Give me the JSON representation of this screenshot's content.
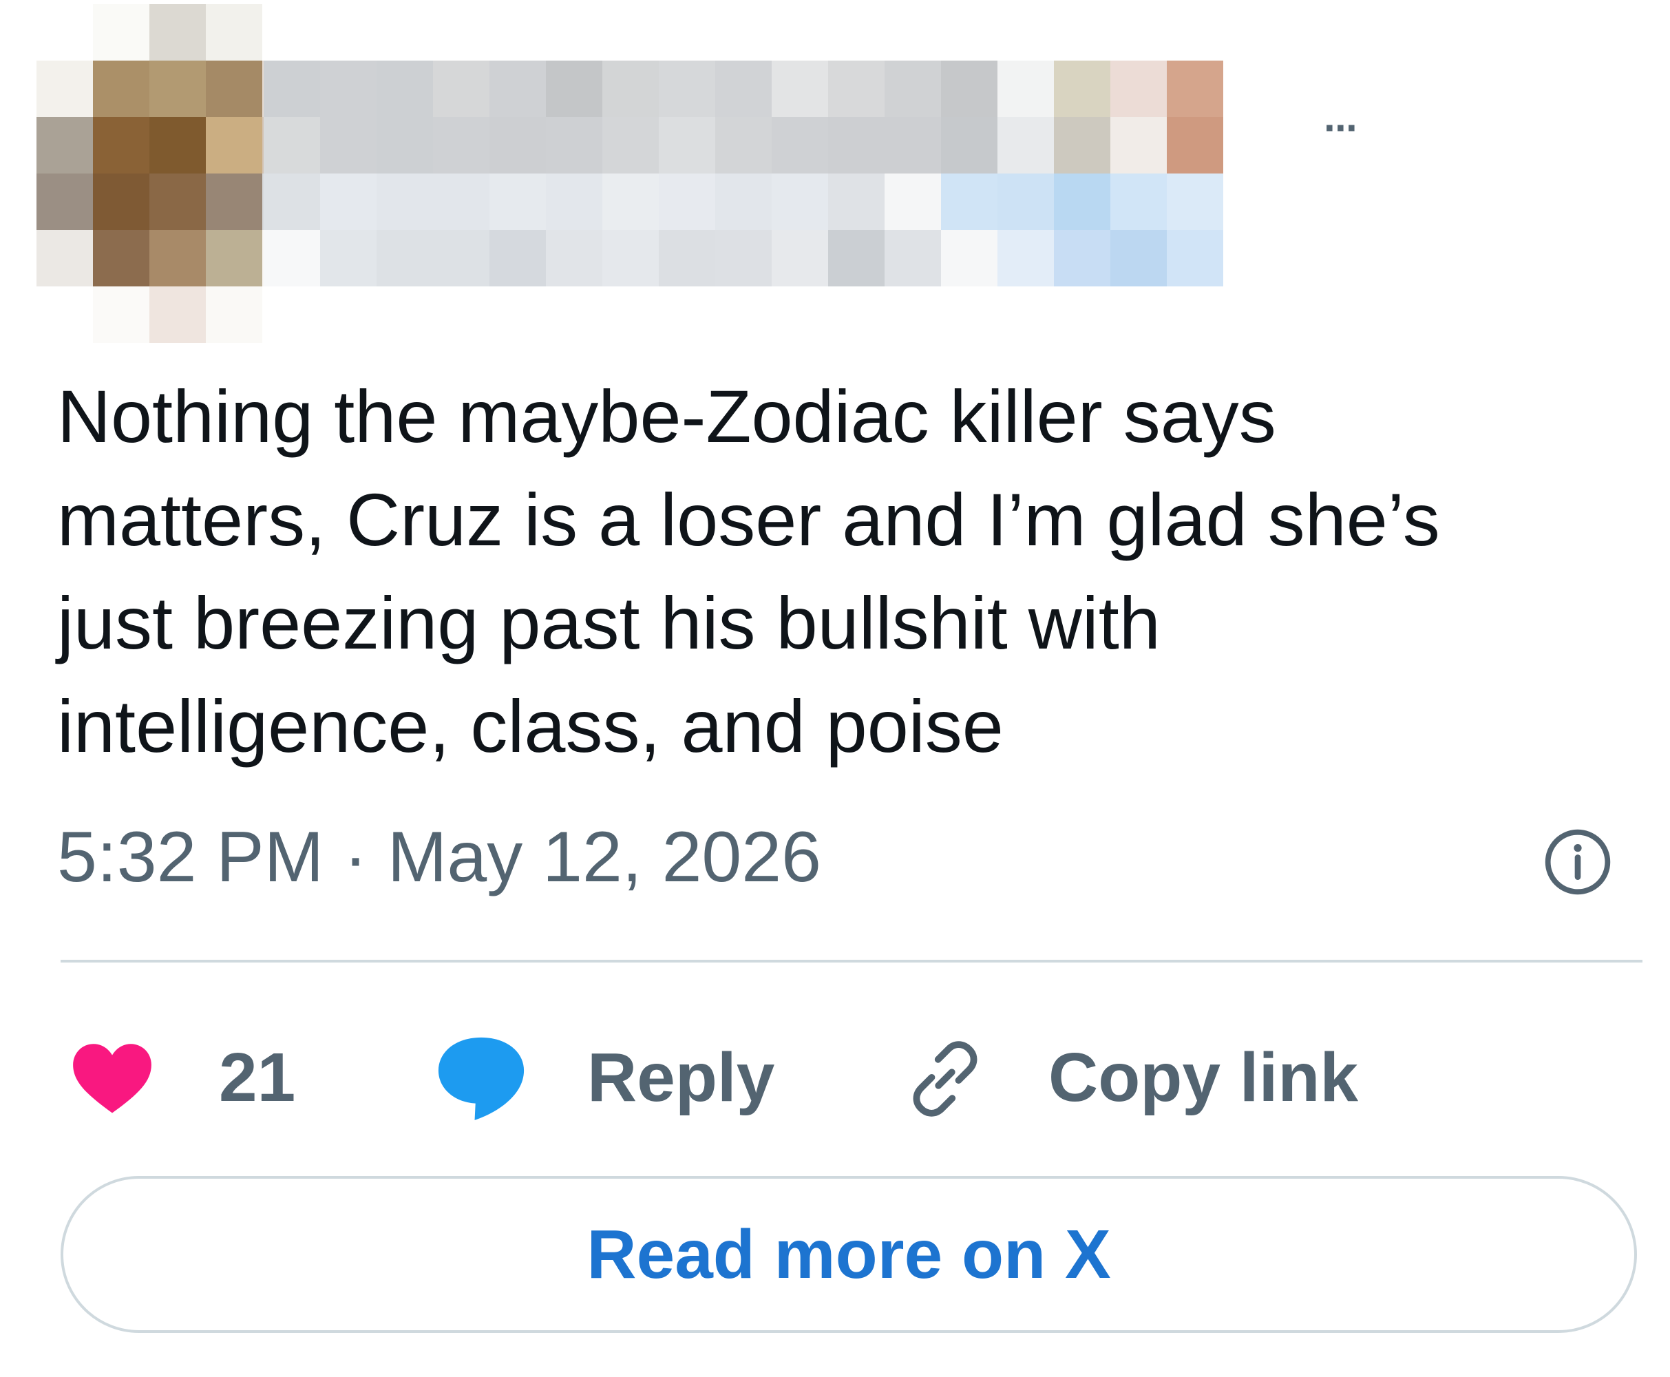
{
  "tweet": {
    "more_icon": "ellipsis-icon",
    "more_label": "···",
    "text": "Nothing the maybe-Zodiac killer says\nmatters, Cruz is a loser and I’m glad she’s\njust breezing past his bullshit with\nintelligence, class, and poise",
    "timestamp": "5:32 PM · May 12, 2026",
    "info_icon": "info-icon"
  },
  "actions": {
    "like_count": "21",
    "like_icon": "heart-icon",
    "reply_label": "Reply",
    "reply_icon": "speech-bubble-icon",
    "copy_label": "Copy link",
    "copy_icon": "link-icon"
  },
  "read_more": {
    "label": "Read more on X"
  },
  "colors": {
    "like": "#f91880",
    "reply": "#1d9bf0",
    "meta_text": "#536471",
    "link_text": "#1d74d0",
    "border": "#cfd9de"
  }
}
